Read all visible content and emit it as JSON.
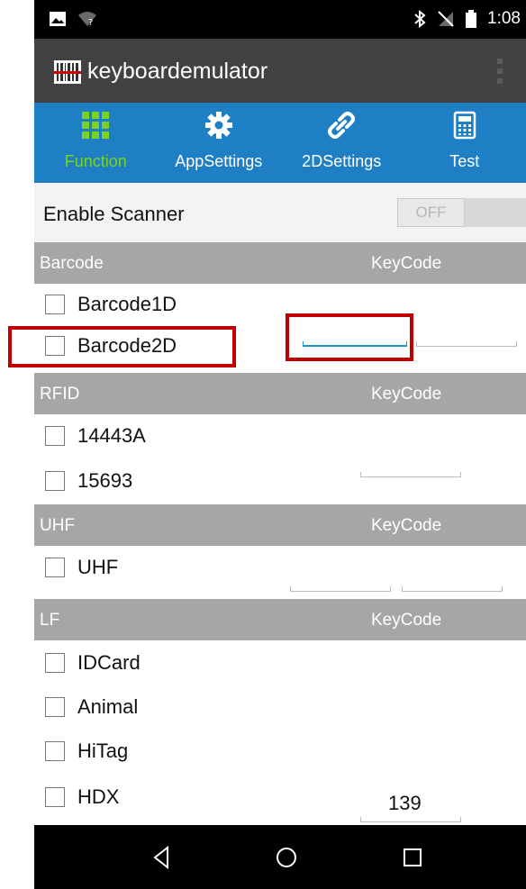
{
  "status_bar": {
    "time": "1:08"
  },
  "app_bar": {
    "title": "keyboardemulator"
  },
  "tabs": [
    {
      "label": "Function",
      "icon": "grid-icon",
      "active": true
    },
    {
      "label": "AppSettings",
      "icon": "gear-icon",
      "active": false
    },
    {
      "label": "2DSettings",
      "icon": "link-icon",
      "active": false
    },
    {
      "label": "Test",
      "icon": "calculator-icon",
      "active": false
    }
  ],
  "enable_scanner": {
    "label": "Enable Scanner",
    "toggle": "OFF"
  },
  "sections": {
    "barcode": {
      "title": "Barcode",
      "keycode_label": "KeyCode",
      "items": [
        "Barcode1D",
        "Barcode2D"
      ]
    },
    "rfid": {
      "title": "RFID",
      "keycode_label": "KeyCode",
      "items": [
        "14443A",
        "15693"
      ]
    },
    "uhf": {
      "title": "UHF",
      "keycode_label": "KeyCode",
      "items": [
        "UHF"
      ]
    },
    "lf": {
      "title": "LF",
      "keycode_label": "KeyCode",
      "items": [
        "IDCard",
        "Animal",
        "HiTag",
        "HDX"
      ],
      "hdx_value": "139"
    }
  },
  "colors": {
    "accent": "#1f7fc4",
    "active_tab": "#7ad321",
    "highlight": "#c00000",
    "header": "#a6a6a6"
  }
}
